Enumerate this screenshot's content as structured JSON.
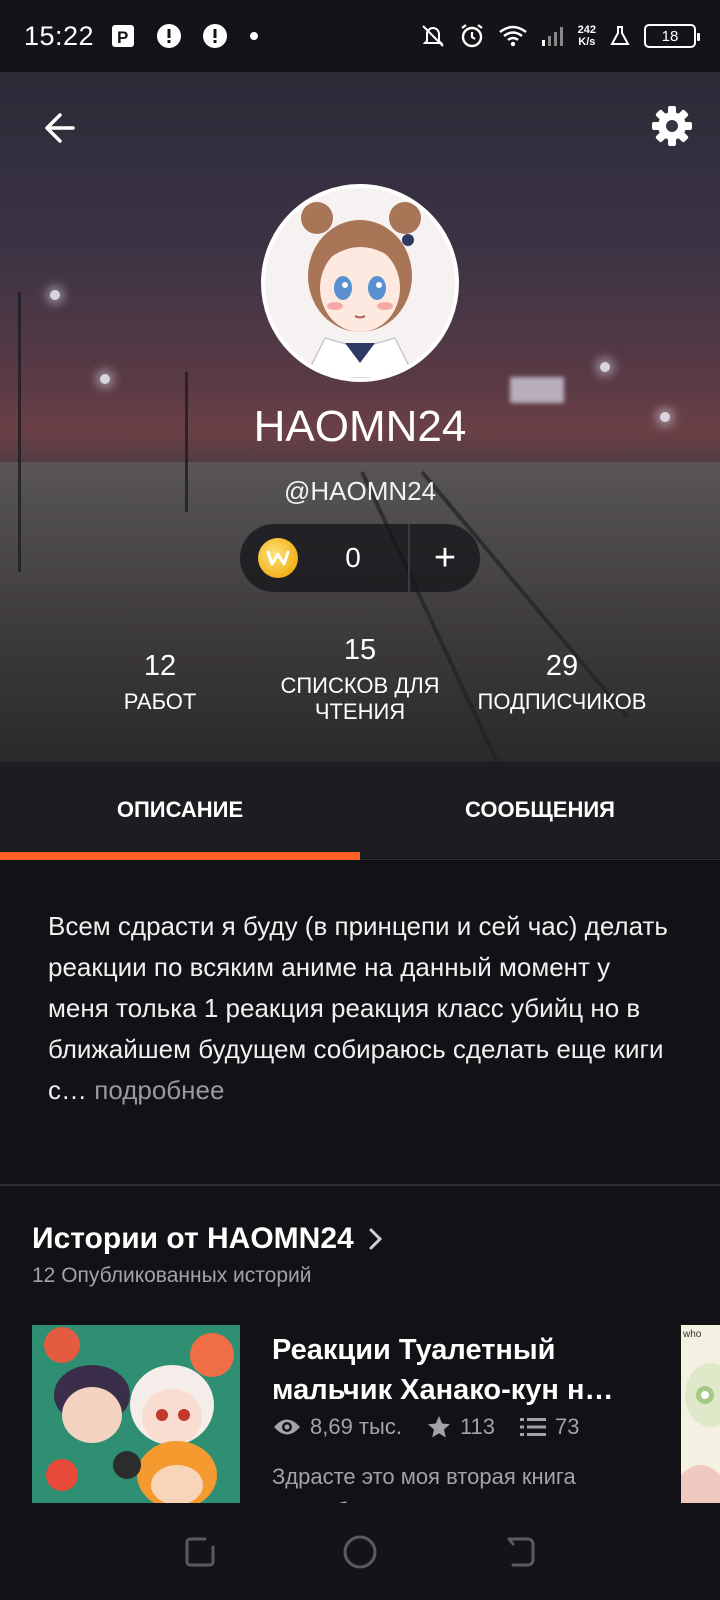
{
  "status_bar": {
    "time": "15:22",
    "network_speed": "242",
    "network_speed_unit": "K/s",
    "battery": "18"
  },
  "profile": {
    "display_name": "HAOMN24",
    "handle": "@HAOMN24",
    "coins": "0",
    "coins_add": "+"
  },
  "stats": [
    {
      "value": "12",
      "label": "РАБОТ"
    },
    {
      "value": "15",
      "label": "СПИСКОВ ДЛЯ ЧТЕНИЯ"
    },
    {
      "value": "29",
      "label": "ПОДПИСЧИКОВ"
    }
  ],
  "tabs": [
    {
      "label": "ОПИСАНИЕ",
      "active": true
    },
    {
      "label": "СООБЩЕНИЯ",
      "active": false
    }
  ],
  "about": {
    "text": "Всем сдрасти я буду (в принцепи и сей час) делать реакции по всяким аниме на данный момент у меня толька 1 реакция реакция класс убийц но в ближайшем будущем собираюсь сделать еще киги с…",
    "more_label": "подробнее"
  },
  "stories": {
    "title": "Истории от HAOMN24",
    "subtitle": "12 Опубликованных историй",
    "items": [
      {
        "title": "Реакции Туалетный мальчик Ханако-кун н…",
        "reads": "8,69 тыс.",
        "votes": "113",
        "parts": "73",
        "description": "Здрасте это моя вторая книга здесь будут реакции"
      }
    ]
  },
  "colors": {
    "accent": "#ff6122",
    "background": "#121115",
    "tab_bar": "#1d1c21"
  }
}
